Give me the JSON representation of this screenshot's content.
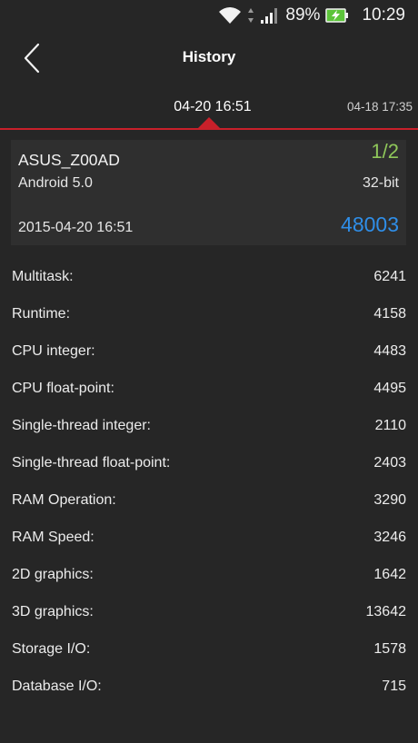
{
  "status_bar": {
    "battery_percent": "89%",
    "time": "10:29",
    "battery_level": 0.89,
    "icons": [
      "wifi-icon",
      "signal-icon",
      "battery-charging-icon"
    ]
  },
  "app_bar": {
    "title": "History",
    "back_icon": "back-chevron-icon"
  },
  "tabs": {
    "active": "04-20 16:51",
    "next": "04-18 17:35"
  },
  "device": {
    "name": "ASUS_Z00AD",
    "page": "1/2",
    "os": "Android 5.0",
    "arch": "32-bit",
    "date": "2015-04-20 16:51",
    "score": "48003"
  },
  "results": [
    {
      "label": "Multitask:",
      "value": "6241"
    },
    {
      "label": "Runtime:",
      "value": "4158"
    },
    {
      "label": "CPU integer:",
      "value": "4483"
    },
    {
      "label": "CPU float-point:",
      "value": "4495"
    },
    {
      "label": "Single-thread integer:",
      "value": "2110"
    },
    {
      "label": "Single-thread float-point:",
      "value": "2403"
    },
    {
      "label": "RAM Operation:",
      "value": "3290"
    },
    {
      "label": "RAM Speed:",
      "value": "3246"
    },
    {
      "label": "2D graphics:",
      "value": "1642"
    },
    {
      "label": "3D graphics:",
      "value": "13642"
    },
    {
      "label": "Storage I/O:",
      "value": "1578"
    },
    {
      "label": "Database I/O:",
      "value": "715"
    }
  ],
  "colors": {
    "background": "#262626",
    "accent_red": "#c8202a",
    "page_green": "#8fc75a",
    "score_blue": "#2f8ee8",
    "battery_green": "#5cc43a"
  }
}
